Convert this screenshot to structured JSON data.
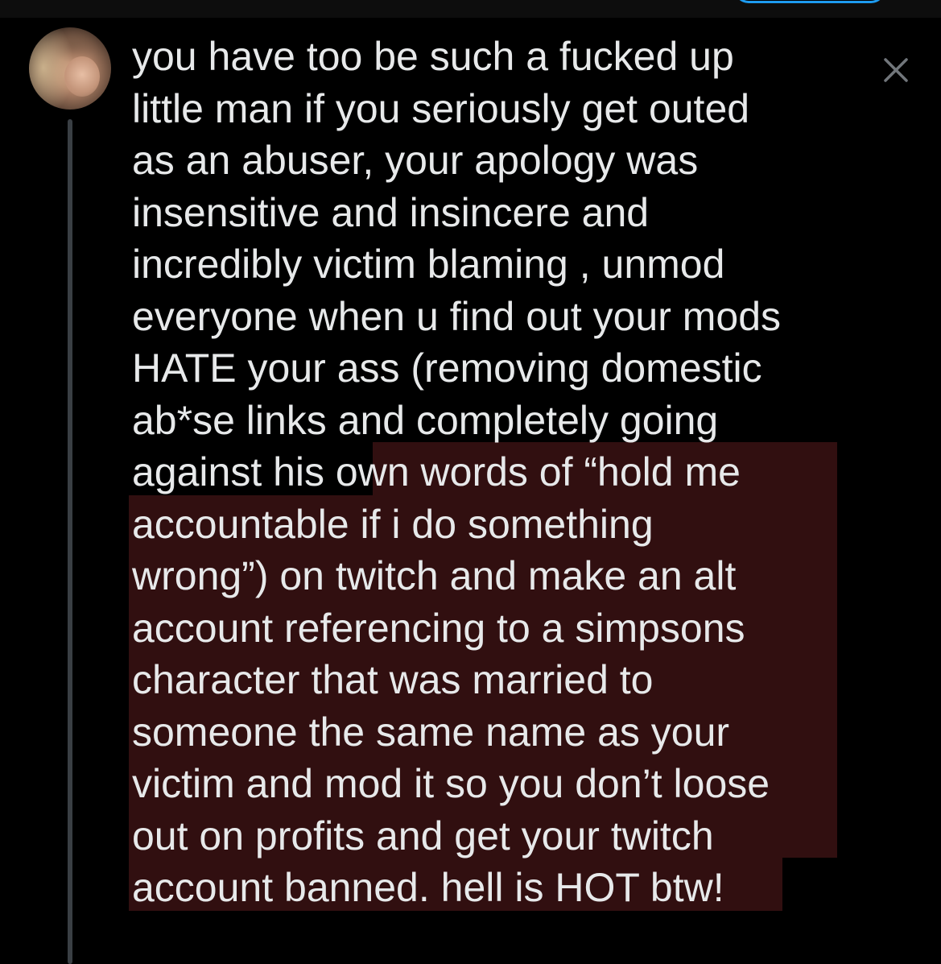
{
  "tweet": {
    "text_lines": [
      "you have too be such a fucked up",
      "little man if you seriously get outed",
      "as an abuser, your apology was",
      "insensitive and insincere and",
      "incredibly victim blaming , unmod",
      "everyone when u find out your mods",
      "HATE your ass (removing domestic",
      "ab*se links and completely going",
      "against his own words of “hold me",
      "accountable if i do something",
      "wrong”) on twitch and make an alt",
      "account referencing to a simpsons",
      "character that was married to",
      "someone the same name as your",
      "victim and mod it so you don’t loose",
      "out on profits and get your twitch",
      "account banned. hell is HOT btw!"
    ]
  },
  "icons": {
    "close": "close-icon",
    "avatar": "user-avatar"
  },
  "colors": {
    "background": "#000000",
    "text": "#e7e9ea",
    "highlight": "#310f10",
    "thread_line": "#3a3f44",
    "close_icon": "#71767b",
    "accent": "#1d9bf0"
  }
}
